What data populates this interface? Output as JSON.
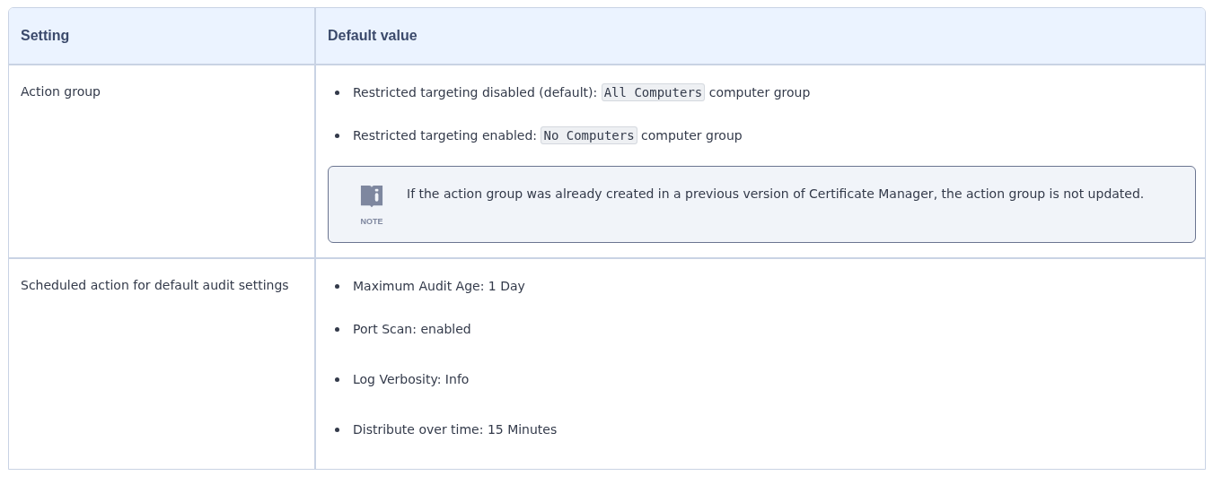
{
  "table": {
    "columns": [
      "Setting",
      "Default value"
    ],
    "rows": [
      {
        "setting": "Action group",
        "values": [
          {
            "before": "Restricted targeting disabled (default): ",
            "code": "All Computers",
            "after": " computer group"
          },
          {
            "before": "Restricted targeting enabled: ",
            "code": "No Computers",
            "after": " computer group"
          }
        ],
        "note": {
          "label": "NOTE",
          "text": "If the action group was already created in a previous version of Certificate Manager, the action group is not updated."
        }
      },
      {
        "setting": "Scheduled action for default audit settings",
        "values": [
          {
            "before": "Maximum Audit Age: 1 Day"
          },
          {
            "before": "Port Scan: enabled"
          },
          {
            "before": "Log Verbosity: Info"
          },
          {
            "before": "Distribute over time: 15 Minutes"
          }
        ]
      }
    ]
  }
}
